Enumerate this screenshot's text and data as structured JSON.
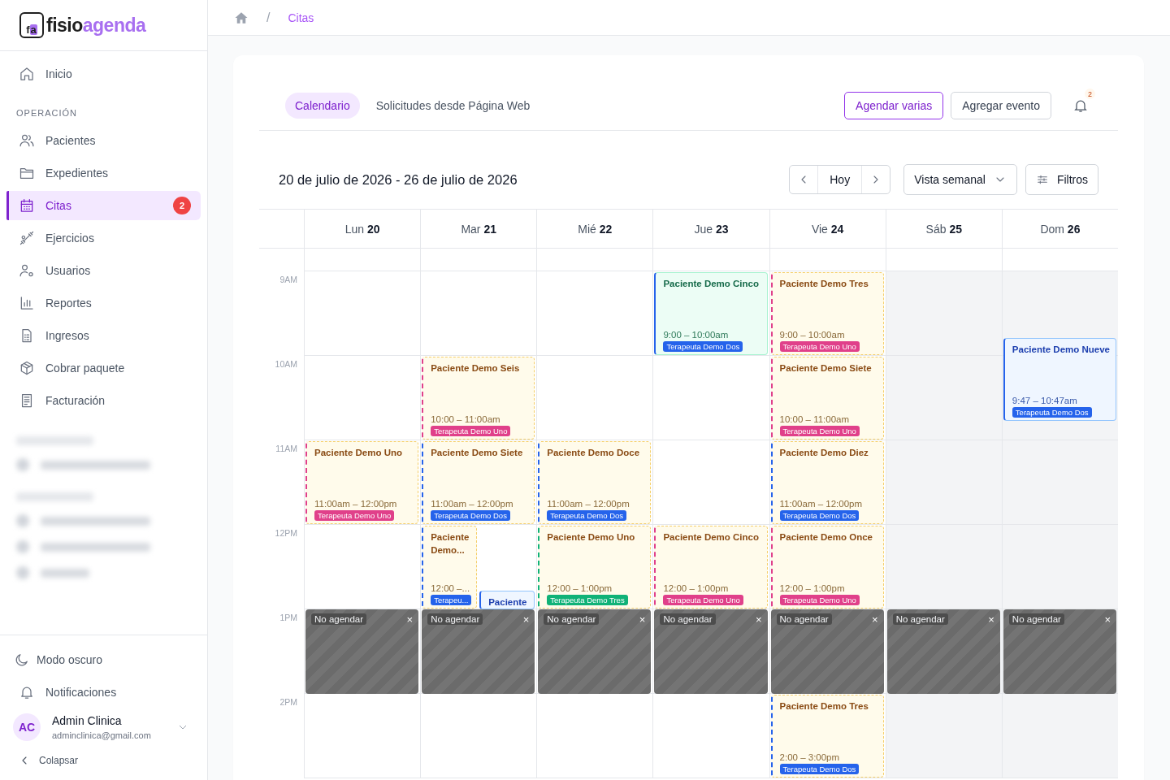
{
  "logo": {
    "mark_first": "f",
    "mark_second": "a",
    "name_first": "fisio",
    "name_second": "agenda"
  },
  "sidebar": {
    "items": [
      {
        "label": "Inicio",
        "selected": false
      }
    ],
    "section": "OPERACIÓN",
    "section_items": [
      {
        "label": "Pacientes",
        "selected": false
      },
      {
        "label": "Expedientes",
        "selected": false
      },
      {
        "label": "Citas",
        "selected": true,
        "badge": "2"
      },
      {
        "label": "Ejercicios",
        "selected": false
      },
      {
        "label": "Usuarios",
        "selected": false
      },
      {
        "label": "Reportes",
        "selected": false
      },
      {
        "label": "Ingresos",
        "selected": false
      },
      {
        "label": "Cobrar paquete",
        "selected": false
      },
      {
        "label": "Facturación",
        "selected": false
      }
    ],
    "bottom": [
      {
        "label": "Modo oscuro"
      },
      {
        "label": "Notificaciones"
      }
    ],
    "user": {
      "initials": "AC",
      "name": "Admin Clinica",
      "email": "adminclinica@gmail.com"
    },
    "collapse": "Colapsar"
  },
  "breadcrumb": {
    "separator": "/",
    "current": "Citas"
  },
  "tabs": [
    {
      "label": "Calendario",
      "selected": true
    },
    {
      "label": "Solicitudes desde Página Web",
      "selected": false
    }
  ],
  "actions": [
    {
      "label": "Agendar varias",
      "kind": "primary"
    },
    {
      "label": "Agregar evento",
      "kind": "secondary"
    }
  ],
  "notifications": {
    "count": "2"
  },
  "range_title": "20 de julio de 2026 - 26 de julio de 2026",
  "nav": {
    "today": "Hoy"
  },
  "view": {
    "label": "Vista semanal"
  },
  "filters": {
    "label": "Filtros"
  },
  "calendar": {
    "hours": [
      "9AM",
      "10AM",
      "11AM",
      "12PM",
      "1PM",
      "2PM"
    ],
    "days": [
      {
        "weekday": "Lun",
        "number": "20",
        "slots": [
          {
            "closed": false
          },
          {
            "closed": false
          },
          {
            "closed": false,
            "events": [
              {
                "kind": "pending",
                "title": "Paciente Demo Uno",
                "time": "11:00am – 12:00pm",
                "therapist": "Terapeuta Demo Uno",
                "color": "#e0408a"
              }
            ]
          },
          {
            "closed": false
          },
          {
            "closed": false,
            "block": {
              "label": "No agendar",
              "close": "×"
            }
          },
          {
            "closed": false
          }
        ]
      },
      {
        "weekday": "Mar",
        "number": "21",
        "slots": [
          {
            "closed": false
          },
          {
            "closed": false,
            "events": [
              {
                "kind": "pending",
                "title": "Paciente Demo Seis",
                "time": "10:00 – 11:00am",
                "therapist": "Terapeuta Demo Uno",
                "color": "#e0408a"
              }
            ]
          },
          {
            "closed": false,
            "events": [
              {
                "kind": "pending",
                "title": "Paciente Demo Siete",
                "time": "11:00am – 12:00pm",
                "therapist": "Terapeuta Demo Dos",
                "color": "#2563eb"
              }
            ]
          },
          {
            "closed": false,
            "events": [
              {
                "kind": "pending",
                "title": "Paciente Demo...",
                "time": "12:00 –...",
                "therapist": "Terapeu...",
                "color": "#2563eb"
              },
              {
                "kind": "scheduled",
                "title": "Paciente"
              }
            ]
          },
          {
            "closed": false,
            "block": {
              "label": "No agendar",
              "close": "×"
            }
          },
          {
            "closed": false
          }
        ]
      },
      {
        "weekday": "Mié",
        "number": "22",
        "slots": [
          {
            "closed": false
          },
          {
            "closed": false
          },
          {
            "closed": false,
            "events": [
              {
                "kind": "pending",
                "title": "Paciente Demo Doce",
                "time": "11:00am – 12:00pm",
                "therapist": "Terapeuta Demo Dos",
                "color": "#2563eb"
              }
            ]
          },
          {
            "closed": false,
            "events": [
              {
                "kind": "pending",
                "title": "Paciente Demo Uno",
                "time": "12:00 – 1:00pm",
                "therapist": "Terapeuta Demo Tres",
                "color": "#10b277"
              }
            ]
          },
          {
            "closed": false,
            "block": {
              "label": "No agendar",
              "close": "×"
            }
          },
          {
            "closed": false
          }
        ]
      },
      {
        "weekday": "Jue",
        "number": "23",
        "slots": [
          {
            "closed": false,
            "events": [
              {
                "kind": "confirmed",
                "title": "Paciente Demo Cinco",
                "time": "9:00 – 10:00am",
                "therapist": "Terapeuta Demo Dos",
                "color": "#2563eb"
              }
            ]
          },
          {
            "closed": false
          },
          {
            "closed": false
          },
          {
            "closed": false,
            "events": [
              {
                "kind": "pending",
                "title": "Paciente Demo Cinco",
                "time": "12:00 – 1:00pm",
                "therapist": "Terapeuta Demo Uno",
                "color": "#e0408a"
              }
            ]
          },
          {
            "closed": false,
            "block": {
              "label": "No agendar",
              "close": "×"
            }
          },
          {
            "closed": false
          }
        ]
      },
      {
        "weekday": "Vie",
        "number": "24",
        "slots": [
          {
            "closed": false,
            "events": [
              {
                "kind": "pending",
                "title": "Paciente Demo Tres",
                "time": "9:00 – 10:00am",
                "therapist": "Terapeuta Demo Uno",
                "color": "#e0408a"
              }
            ]
          },
          {
            "closed": false,
            "events": [
              {
                "kind": "pending",
                "title": "Paciente Demo Siete",
                "time": "10:00 – 11:00am",
                "therapist": "Terapeuta Demo Uno",
                "color": "#e0408a"
              }
            ]
          },
          {
            "closed": false,
            "events": [
              {
                "kind": "pending",
                "title": "Paciente Demo Diez",
                "time": "11:00am – 12:00pm",
                "therapist": "Terapeuta Demo Dos",
                "color": "#2563eb"
              }
            ]
          },
          {
            "closed": false,
            "events": [
              {
                "kind": "pending",
                "title": "Paciente Demo Once",
                "time": "12:00 – 1:00pm",
                "therapist": "Terapeuta Demo Uno",
                "color": "#e0408a"
              }
            ]
          },
          {
            "closed": false,
            "block": {
              "label": "No agendar",
              "close": "×"
            }
          },
          {
            "closed": false,
            "events": [
              {
                "kind": "pending",
                "title": "Paciente Demo Tres",
                "time": "2:00 – 3:00pm",
                "therapist": "Terapeuta Demo Dos",
                "color": "#2563eb"
              }
            ]
          }
        ]
      },
      {
        "weekday": "Sáb",
        "number": "25",
        "slots": [
          {
            "closed": true
          },
          {
            "closed": true
          },
          {
            "closed": true
          },
          {
            "closed": true
          },
          {
            "closed": true,
            "block": {
              "label": "No agendar",
              "close": "×"
            }
          },
          {
            "closed": true
          }
        ]
      },
      {
        "weekday": "Dom",
        "number": "26",
        "slots": [
          {
            "closed": true,
            "events": [
              {
                "kind": "scheduled",
                "title": "Paciente Demo Nueve",
                "time": "9:47 – 10:47am",
                "therapist": "Terapeuta Demo Dos",
                "color": "#2563eb"
              }
            ]
          },
          {
            "closed": true
          },
          {
            "closed": true
          },
          {
            "closed": true
          },
          {
            "closed": true,
            "block": {
              "label": "No agendar",
              "close": "×"
            }
          },
          {
            "closed": true
          }
        ]
      }
    ]
  }
}
